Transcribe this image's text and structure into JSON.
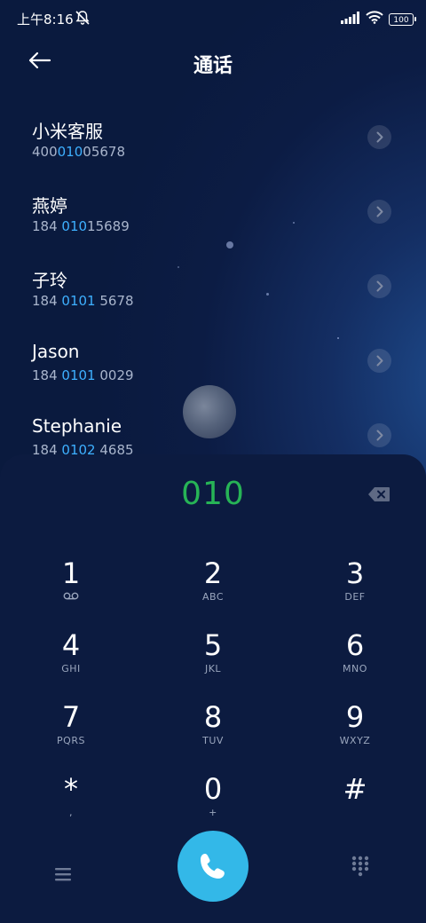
{
  "status_bar": {
    "time": "上午8:16",
    "battery": "100"
  },
  "header": {
    "title": "通话"
  },
  "contacts": [
    {
      "name": "小米客服",
      "num_a": "400",
      "num_hl": "010",
      "num_b": "05678"
    },
    {
      "name": "燕婷",
      "num_a": "184 ",
      "num_hl": "010",
      "num_b": "15689"
    },
    {
      "name": "子玲",
      "num_a": "184 ",
      "num_hl": "0101",
      "num_b": " 5678"
    },
    {
      "name": "Jason",
      "num_a": "184 ",
      "num_hl": "0101",
      "num_b": " 0029"
    },
    {
      "name": "Stephanie",
      "num_a": "184 ",
      "num_hl": "0102",
      "num_b": " 4685"
    }
  ],
  "dialer": {
    "entry": "010",
    "keys": [
      {
        "digit": "1",
        "letters": ""
      },
      {
        "digit": "2",
        "letters": "ABC"
      },
      {
        "digit": "3",
        "letters": "DEF"
      },
      {
        "digit": "4",
        "letters": "GHI"
      },
      {
        "digit": "5",
        "letters": "JKL"
      },
      {
        "digit": "6",
        "letters": "MNO"
      },
      {
        "digit": "7",
        "letters": "PQRS"
      },
      {
        "digit": "8",
        "letters": "TUV"
      },
      {
        "digit": "9",
        "letters": "WXYZ"
      },
      {
        "digit": "*",
        "letters": ","
      },
      {
        "digit": "0",
        "letters": "+"
      },
      {
        "digit": "#",
        "letters": ""
      }
    ]
  },
  "colors": {
    "accent": "#3eb0ff",
    "entry": "#27b456",
    "call": "#33b8e8"
  },
  "icons": {
    "back": "arrow-left-icon",
    "delete": "backspace-icon",
    "menu": "menu-icon",
    "call": "phone-icon",
    "dialpad": "dialpad-icon",
    "voicemail": "voicemail-icon"
  }
}
